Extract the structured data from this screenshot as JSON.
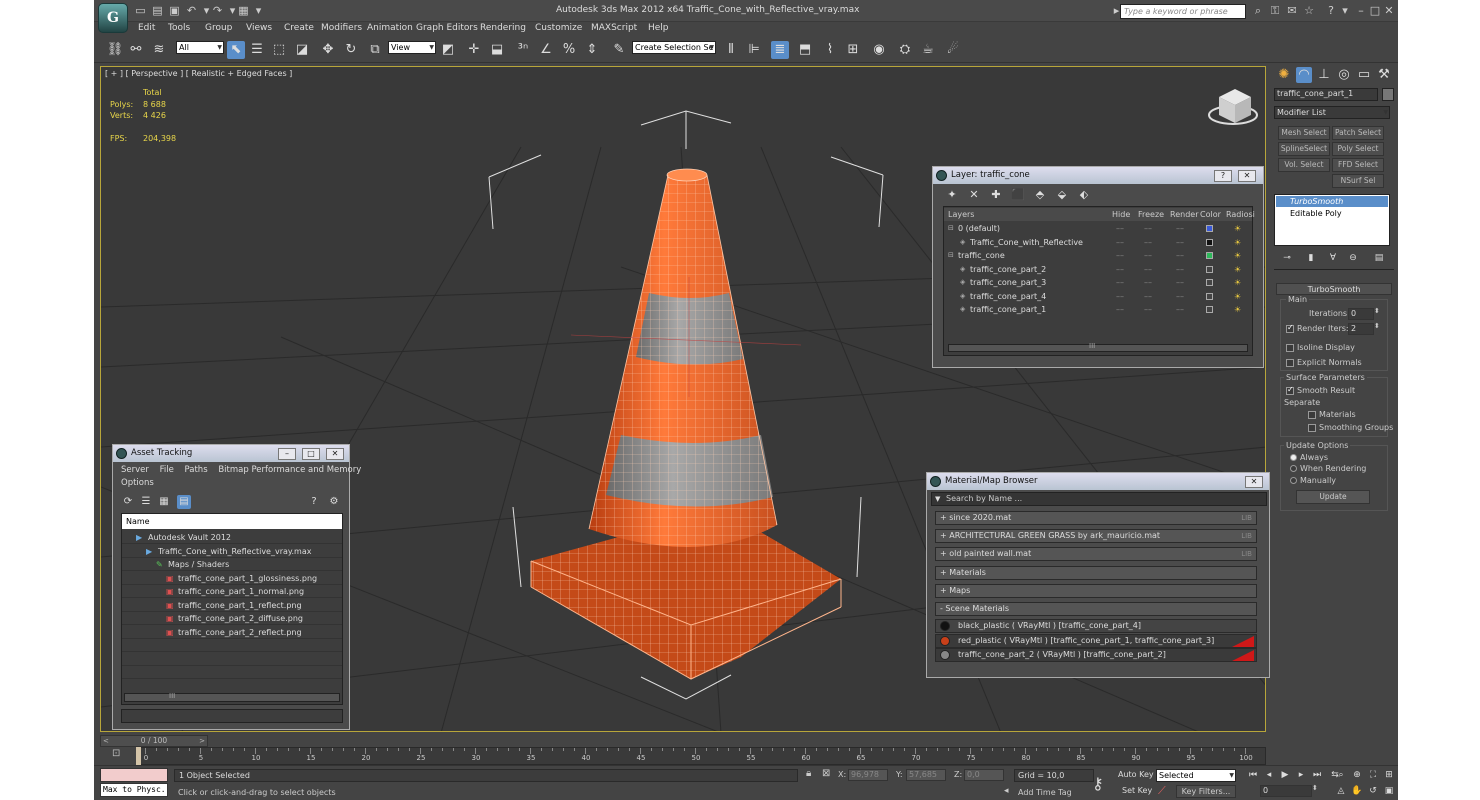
{
  "app": {
    "logo": "G",
    "title": "Autodesk 3ds Max  2012 x64      Traffic_Cone_with_Reflective_vray.max",
    "search_placeholder": "Type a keyword or phrase"
  },
  "menu": [
    "Edit",
    "Tools",
    "Group",
    "Views",
    "Create",
    "Modifiers",
    "Animation",
    "Graph Editors",
    "Rendering",
    "Customize",
    "MAXScript",
    "Help"
  ],
  "toolbar": {
    "filter": "All",
    "ref_coord": "View",
    "selection_set": "Create Selection Se"
  },
  "viewport": {
    "label": "[ + ] [ Perspective ] [ Realistic + Edged Faces ]",
    "stats": {
      "total": "Total",
      "polys_label": "Polys:",
      "polys": "8 688",
      "verts_label": "Verts:",
      "verts": "4 426",
      "fps_label": "FPS:",
      "fps": "204,398"
    }
  },
  "layer_dialog": {
    "title": "Layer: traffic_cone",
    "columns": [
      "Layers",
      "Hide",
      "Freeze",
      "Render",
      "Color",
      "Radiosi"
    ],
    "rows": [
      {
        "name": "0 (default)",
        "indent": 0,
        "color": "#3a5ad8"
      },
      {
        "name": "Traffic_Cone_with_Reflective",
        "indent": 1,
        "color": "#111111"
      },
      {
        "name": "traffic_cone",
        "indent": 0,
        "color": "#2db85a"
      },
      {
        "name": "traffic_cone_part_2",
        "indent": 1,
        "color": "#444444"
      },
      {
        "name": "traffic_cone_part_3",
        "indent": 1,
        "color": "#444444"
      },
      {
        "name": "traffic_cone_part_4",
        "indent": 1,
        "color": "#444444"
      },
      {
        "name": "traffic_cone_part_1",
        "indent": 1,
        "color": "#444444"
      }
    ],
    "scroll_mark": "III"
  },
  "asset_tracking": {
    "title": "Asset Tracking",
    "menu": [
      "Server",
      "File",
      "Paths",
      "Bitmap Performance and Memory",
      "Options"
    ],
    "column": "Name",
    "items": [
      {
        "label": "Autodesk Vault 2012",
        "indent": 1
      },
      {
        "label": "Traffic_Cone_with_Reflective_vray.max",
        "indent": 2
      },
      {
        "label": "Maps / Shaders",
        "indent": 3
      },
      {
        "label": "traffic_cone_part_1_glossiness.png",
        "indent": 4
      },
      {
        "label": "traffic_cone_part_1_normal.png",
        "indent": 4
      },
      {
        "label": "traffic_cone_part_1_reflect.png",
        "indent": 4
      },
      {
        "label": "traffic_cone_part_2_diffuse.png",
        "indent": 4
      },
      {
        "label": "traffic_cone_part_2_reflect.png",
        "indent": 4
      }
    ],
    "scroll_mark": "III"
  },
  "material_browser": {
    "title": "Material/Map Browser",
    "search_placeholder": "Search by Name ...",
    "groups": [
      {
        "label": "+ since 2020.mat",
        "lib": "LIB"
      },
      {
        "label": "+ ARCHITECTURAL GREEN GRASS by ark_mauricio.mat",
        "lib": "LIB"
      },
      {
        "label": "+ old painted wall.mat",
        "lib": "LIB"
      },
      {
        "label": "+ Materials",
        "lib": ""
      },
      {
        "label": "+ Maps",
        "lib": ""
      },
      {
        "label": "- Scene Materials",
        "lib": ""
      }
    ],
    "scene_materials": [
      {
        "label": "black_plastic  ( VRayMtl ) [traffic_cone_part_4]",
        "swatch": "#111111",
        "selected": false
      },
      {
        "label": "red_plastic  ( VRayMtl ) [traffic_cone_part_1, traffic_cone_part_3]",
        "swatch": "#c8401a",
        "selected": true
      },
      {
        "label": "traffic_cone_part_2  ( VRayMtl ) [traffic_cone_part_2]",
        "swatch": "#888888",
        "selected": true
      }
    ]
  },
  "command_panel": {
    "object_name": "traffic_cone_part_1",
    "modifier_list": "Modifier List",
    "buttons": [
      "Mesh Select",
      "Patch Select",
      "SplineSelect",
      "Poly Select",
      "Vol. Select",
      "FFD Select",
      "",
      "NSurf Sel"
    ],
    "stack": [
      {
        "label": "TurboSmooth",
        "selected": true
      },
      {
        "label": "Editable Poly",
        "selected": false
      }
    ],
    "rollout_title": "TurboSmooth",
    "main": "Main",
    "iterations_label": "Iterations:",
    "iterations": "0",
    "render_iters_label": "Render Iters:",
    "render_iters": "2",
    "isoline": "Isoline Display",
    "explicit_normals": "Explicit Normals",
    "surface_params": "Surface Parameters",
    "smooth_result": "Smooth Result",
    "separate": "Separate",
    "materials": "Materials",
    "smoothing_groups": "Smoothing Groups",
    "update_options": "Update Options",
    "always": "Always",
    "when_rendering": "When Rendering",
    "manually": "Manually",
    "update_btn": "Update"
  },
  "timeline": {
    "frame_label": "0 / 100",
    "ticks": [
      "0",
      "5",
      "10",
      "15",
      "20",
      "25",
      "30",
      "35",
      "40",
      "45",
      "50",
      "55",
      "60",
      "65",
      "70",
      "75",
      "80",
      "85",
      "90",
      "95",
      "100"
    ]
  },
  "status": {
    "script_label": "Max to Physc.",
    "selection": "1 Object Selected",
    "prompt": "Click or click-and-drag to select objects",
    "x_label": "X:",
    "x": "96,978",
    "y_label": "Y:",
    "y": "57,685",
    "z_label": "Z:",
    "z": "0,0",
    "grid": "Grid = 10,0",
    "add_time_tag": "Add Time Tag",
    "auto_key": "Auto Key",
    "set_key": "Set Key",
    "key_mode": "Selected",
    "key_filters": "Key Filters...",
    "frame": "0"
  }
}
